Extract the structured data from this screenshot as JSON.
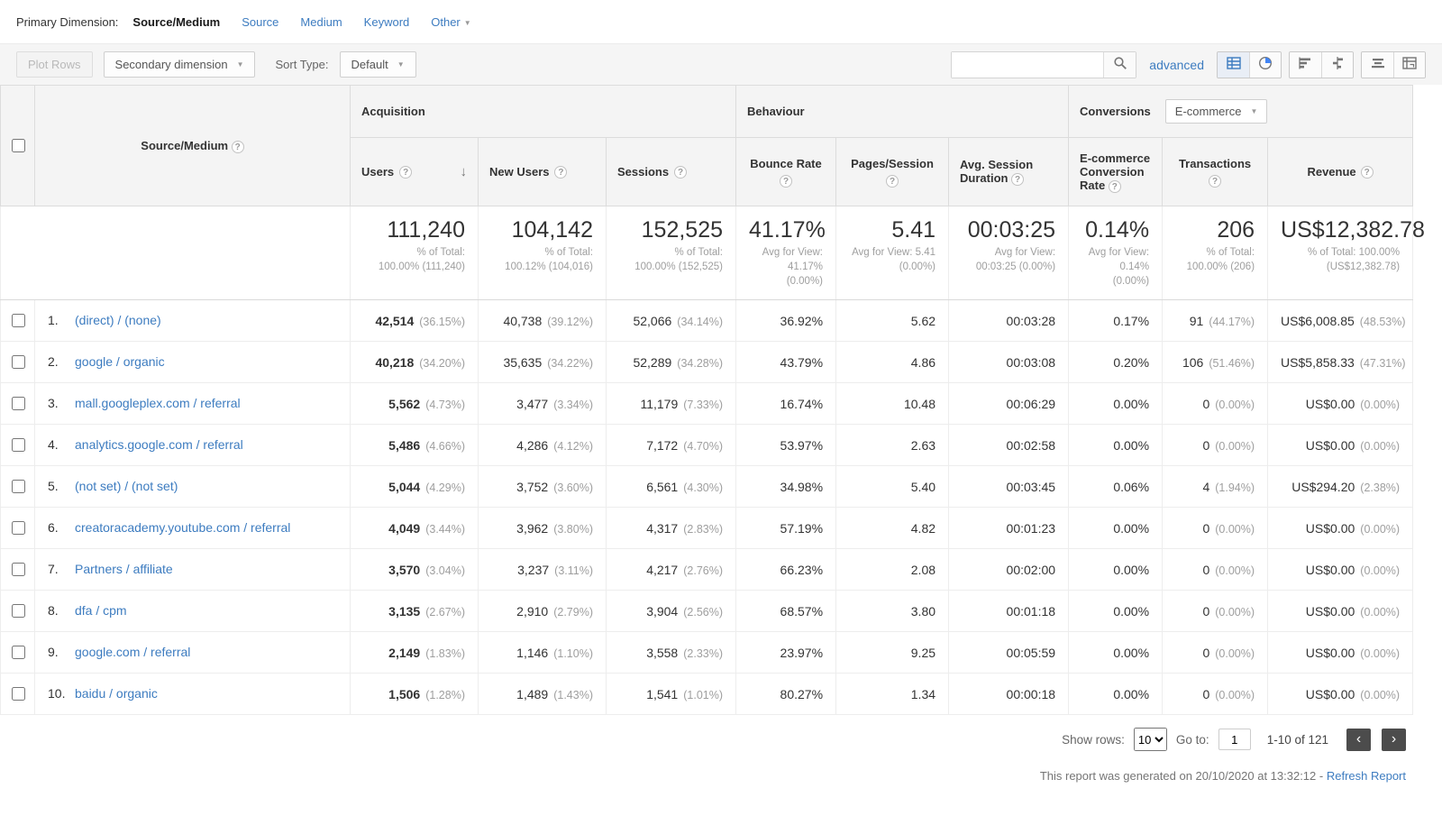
{
  "colors": {
    "link": "#3d7cc0",
    "accent": "#4285f4",
    "toolbar_bg": "#f5f5f5",
    "header_bg": "#f4f4f4",
    "muted_text": "#9e9e9e",
    "dark_button": "#4c4c4c"
  },
  "icons": {
    "help": "?",
    "caret_down": "▼",
    "sort_descending": "↓",
    "prev_page": "‹",
    "next_page": "›"
  },
  "primary_dimension": {
    "label": "Primary Dimension:",
    "active_tab": "Source/Medium",
    "tabs": [
      "Source",
      "Medium",
      "Keyword"
    ],
    "other_tab": "Other"
  },
  "toolbar": {
    "plot_rows_label": "Plot Rows",
    "secondary_dimension_label": "Secondary dimension",
    "sort_type_label": "Sort Type:",
    "sort_type_value": "Default",
    "search_value": "",
    "advanced_label": "advanced"
  },
  "table": {
    "dimension_header": "Source/Medium",
    "groups": {
      "acquisition": "Acquisition",
      "behaviour": "Behaviour",
      "conversions": "Conversions",
      "conversions_selector": "E-commerce"
    },
    "metric_headers": [
      {
        "label": "Users",
        "sorted": "descending"
      },
      {
        "label": "New Users"
      },
      {
        "label": "Sessions"
      },
      {
        "label": "Bounce Rate"
      },
      {
        "label": "Pages/Session"
      },
      {
        "label": "Avg. Session Duration"
      },
      {
        "label": "E-commerce Conversion Rate"
      },
      {
        "label": "Transactions"
      },
      {
        "label": "Revenue"
      }
    ],
    "summary": [
      {
        "value": "111,240",
        "sub": "% of Total: 100.00% (111,240)"
      },
      {
        "value": "104,142",
        "sub": "% of Total: 100.12% (104,016)"
      },
      {
        "value": "152,525",
        "sub": "% of Total: 100.00% (152,525)"
      },
      {
        "value": "41.17%",
        "sub": "Avg for View: 41.17% (0.00%)"
      },
      {
        "value": "5.41",
        "sub": "Avg for View: 5.41 (0.00%)"
      },
      {
        "value": "00:03:25",
        "sub": "Avg for View: 00:03:25 (0.00%)"
      },
      {
        "value": "0.14%",
        "sub": "Avg for View: 0.14% (0.00%)"
      },
      {
        "value": "206",
        "sub": "% of Total: 100.00% (206)"
      },
      {
        "value": "US$12,382.78",
        "sub": "% of Total: 100.00% (US$12,382.78)"
      }
    ],
    "rows": [
      {
        "num": "1.",
        "source": "(direct) / (none)",
        "metrics": [
          {
            "main": "42,514",
            "sub": "(36.15%)"
          },
          {
            "main": "40,738",
            "sub": "(39.12%)"
          },
          {
            "main": "52,066",
            "sub": "(34.14%)"
          },
          {
            "main": "36.92%"
          },
          {
            "main": "5.62"
          },
          {
            "main": "00:03:28"
          },
          {
            "main": "0.17%"
          },
          {
            "main": "91",
            "sub": "(44.17%)"
          },
          {
            "main": "US$6,008.85",
            "sub": "(48.53%)"
          }
        ]
      },
      {
        "num": "2.",
        "source": "google / organic",
        "metrics": [
          {
            "main": "40,218",
            "sub": "(34.20%)"
          },
          {
            "main": "35,635",
            "sub": "(34.22%)"
          },
          {
            "main": "52,289",
            "sub": "(34.28%)"
          },
          {
            "main": "43.79%"
          },
          {
            "main": "4.86"
          },
          {
            "main": "00:03:08"
          },
          {
            "main": "0.20%"
          },
          {
            "main": "106",
            "sub": "(51.46%)"
          },
          {
            "main": "US$5,858.33",
            "sub": "(47.31%)"
          }
        ]
      },
      {
        "num": "3.",
        "source": "mall.googleplex.com / referral",
        "metrics": [
          {
            "main": "5,562",
            "sub": "(4.73%)"
          },
          {
            "main": "3,477",
            "sub": "(3.34%)"
          },
          {
            "main": "11,179",
            "sub": "(7.33%)"
          },
          {
            "main": "16.74%"
          },
          {
            "main": "10.48"
          },
          {
            "main": "00:06:29"
          },
          {
            "main": "0.00%"
          },
          {
            "main": "0",
            "sub": "(0.00%)"
          },
          {
            "main": "US$0.00",
            "sub": "(0.00%)"
          }
        ]
      },
      {
        "num": "4.",
        "source": "analytics.google.com / referral",
        "metrics": [
          {
            "main": "5,486",
            "sub": "(4.66%)"
          },
          {
            "main": "4,286",
            "sub": "(4.12%)"
          },
          {
            "main": "7,172",
            "sub": "(4.70%)"
          },
          {
            "main": "53.97%"
          },
          {
            "main": "2.63"
          },
          {
            "main": "00:02:58"
          },
          {
            "main": "0.00%"
          },
          {
            "main": "0",
            "sub": "(0.00%)"
          },
          {
            "main": "US$0.00",
            "sub": "(0.00%)"
          }
        ]
      },
      {
        "num": "5.",
        "source": "(not set) / (not set)",
        "metrics": [
          {
            "main": "5,044",
            "sub": "(4.29%)"
          },
          {
            "main": "3,752",
            "sub": "(3.60%)"
          },
          {
            "main": "6,561",
            "sub": "(4.30%)"
          },
          {
            "main": "34.98%"
          },
          {
            "main": "5.40"
          },
          {
            "main": "00:03:45"
          },
          {
            "main": "0.06%"
          },
          {
            "main": "4",
            "sub": "(1.94%)"
          },
          {
            "main": "US$294.20",
            "sub": "(2.38%)"
          }
        ]
      },
      {
        "num": "6.",
        "source": "creatoracademy.youtube.com / referral",
        "metrics": [
          {
            "main": "4,049",
            "sub": "(3.44%)"
          },
          {
            "main": "3,962",
            "sub": "(3.80%)"
          },
          {
            "main": "4,317",
            "sub": "(2.83%)"
          },
          {
            "main": "57.19%"
          },
          {
            "main": "4.82"
          },
          {
            "main": "00:01:23"
          },
          {
            "main": "0.00%"
          },
          {
            "main": "0",
            "sub": "(0.00%)"
          },
          {
            "main": "US$0.00",
            "sub": "(0.00%)"
          }
        ]
      },
      {
        "num": "7.",
        "source": "Partners / affiliate",
        "metrics": [
          {
            "main": "3,570",
            "sub": "(3.04%)"
          },
          {
            "main": "3,237",
            "sub": "(3.11%)"
          },
          {
            "main": "4,217",
            "sub": "(2.76%)"
          },
          {
            "main": "66.23%"
          },
          {
            "main": "2.08"
          },
          {
            "main": "00:02:00"
          },
          {
            "main": "0.00%"
          },
          {
            "main": "0",
            "sub": "(0.00%)"
          },
          {
            "main": "US$0.00",
            "sub": "(0.00%)"
          }
        ]
      },
      {
        "num": "8.",
        "source": "dfa / cpm",
        "metrics": [
          {
            "main": "3,135",
            "sub": "(2.67%)"
          },
          {
            "main": "2,910",
            "sub": "(2.79%)"
          },
          {
            "main": "3,904",
            "sub": "(2.56%)"
          },
          {
            "main": "68.57%"
          },
          {
            "main": "3.80"
          },
          {
            "main": "00:01:18"
          },
          {
            "main": "0.00%"
          },
          {
            "main": "0",
            "sub": "(0.00%)"
          },
          {
            "main": "US$0.00",
            "sub": "(0.00%)"
          }
        ]
      },
      {
        "num": "9.",
        "source": "google.com / referral",
        "metrics": [
          {
            "main": "2,149",
            "sub": "(1.83%)"
          },
          {
            "main": "1,146",
            "sub": "(1.10%)"
          },
          {
            "main": "3,558",
            "sub": "(2.33%)"
          },
          {
            "main": "23.97%"
          },
          {
            "main": "9.25"
          },
          {
            "main": "00:05:59"
          },
          {
            "main": "0.00%"
          },
          {
            "main": "0",
            "sub": "(0.00%)"
          },
          {
            "main": "US$0.00",
            "sub": "(0.00%)"
          }
        ]
      },
      {
        "num": "10.",
        "source": "baidu / organic",
        "metrics": [
          {
            "main": "1,506",
            "sub": "(1.28%)"
          },
          {
            "main": "1,489",
            "sub": "(1.43%)"
          },
          {
            "main": "1,541",
            "sub": "(1.01%)"
          },
          {
            "main": "80.27%"
          },
          {
            "main": "1.34"
          },
          {
            "main": "00:00:18"
          },
          {
            "main": "0.00%"
          },
          {
            "main": "0",
            "sub": "(0.00%)"
          },
          {
            "main": "US$0.00",
            "sub": "(0.00%)"
          }
        ]
      }
    ]
  },
  "pagination": {
    "show_rows_label": "Show rows:",
    "show_rows_value": "10",
    "goto_label": "Go to:",
    "goto_value": "1",
    "range": "1-10 of 121"
  },
  "footer": {
    "generated_text": "This report was generated on 20/10/2020 at 13:32:12 -",
    "refresh_label": "Refresh Report"
  }
}
